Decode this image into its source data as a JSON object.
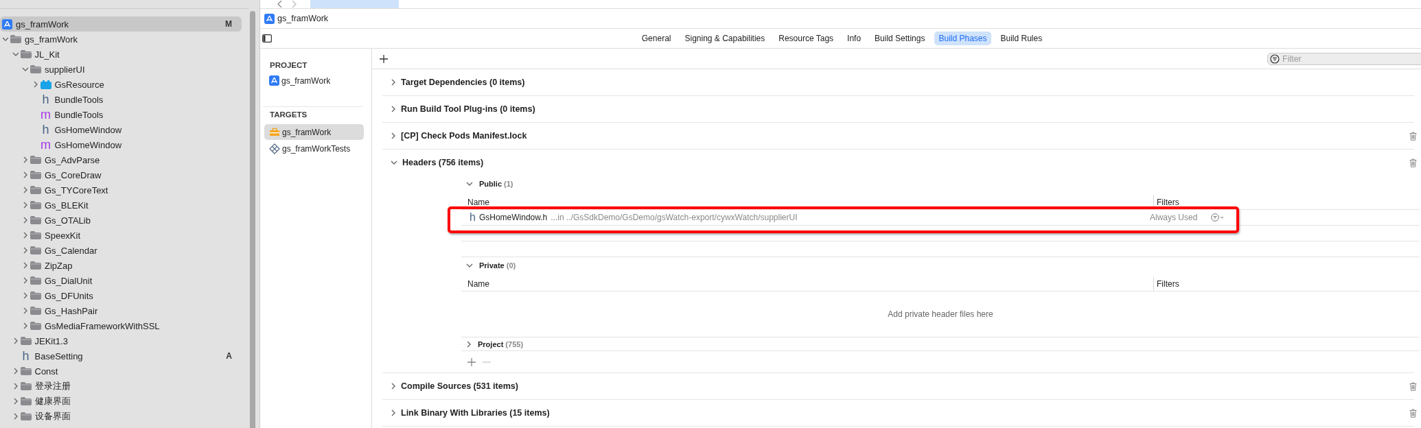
{
  "navigator": {
    "project": {
      "name": "gs_framWork",
      "badge": "M",
      "selected": true
    },
    "tree": [
      {
        "name": "gs_framWork",
        "kind": "folder",
        "expanded": true,
        "selected": false,
        "children": [
          {
            "name": "JL_Kit",
            "kind": "folder",
            "expanded": true,
            "selected": false,
            "children": [
              {
                "name": "supplierUI",
                "kind": "folder",
                "expanded": true,
                "selected": false,
                "children": [
                  {
                    "name": "GsResource",
                    "kind": "bundle",
                    "expanded": false,
                    "selected": false
                  },
                  {
                    "name": "BundleTools",
                    "kind": "header",
                    "glyph": "h",
                    "selected": false
                  },
                  {
                    "name": "BundleTools",
                    "kind": "impl",
                    "glyph": "m",
                    "selected": false
                  },
                  {
                    "name": "GsHomeWindow",
                    "kind": "header",
                    "glyph": "h",
                    "selected": false
                  },
                  {
                    "name": "GsHomeWindow",
                    "kind": "impl",
                    "glyph": "m",
                    "selected": false
                  }
                ]
              },
              {
                "name": "Gs_AdvParse",
                "kind": "folder",
                "expanded": false,
                "selected": false
              },
              {
                "name": "Gs_CoreDraw",
                "kind": "folder",
                "expanded": false,
                "selected": false
              },
              {
                "name": "Gs_TYCoreText",
                "kind": "folder",
                "expanded": false,
                "selected": false
              },
              {
                "name": "Gs_BLEKit",
                "kind": "folder",
                "expanded": false,
                "selected": false
              },
              {
                "name": "Gs_OTALib",
                "kind": "folder",
                "expanded": false,
                "selected": false
              },
              {
                "name": "SpeexKit",
                "kind": "folder",
                "expanded": false,
                "selected": false
              },
              {
                "name": "Gs_Calendar",
                "kind": "folder",
                "expanded": false,
                "selected": false
              },
              {
                "name": "ZipZap",
                "kind": "folder",
                "expanded": false,
                "selected": false
              },
              {
                "name": "Gs_DialUnit",
                "kind": "folder",
                "expanded": false,
                "selected": false
              },
              {
                "name": "Gs_DFUnits",
                "kind": "folder",
                "expanded": false,
                "selected": false
              },
              {
                "name": "Gs_HashPair",
                "kind": "folder",
                "expanded": false,
                "selected": false
              },
              {
                "name": "GsMediaFrameworkWithSSL",
                "kind": "folder",
                "expanded": false,
                "selected": false
              }
            ]
          },
          {
            "name": "JEKit1.3",
            "kind": "folder",
            "expanded": false,
            "selected": false
          },
          {
            "name": "BaseSetting",
            "kind": "header",
            "glyph": "h",
            "badge": "A",
            "selected": false
          },
          {
            "name": "Const",
            "kind": "folder",
            "expanded": false,
            "selected": false
          },
          {
            "name": "登录注册",
            "kind": "folder",
            "expanded": false,
            "selected": false
          },
          {
            "name": "健康界面",
            "kind": "folder",
            "expanded": false,
            "selected": false
          },
          {
            "name": "设备界面",
            "kind": "folder",
            "expanded": false,
            "selected": false
          }
        ]
      }
    ]
  },
  "editor": {
    "breadcrumb": "gs_framWork",
    "tabs": [
      {
        "label": "General",
        "selected": false
      },
      {
        "label": "Signing & Capabilities",
        "selected": false
      },
      {
        "label": "Resource Tags",
        "selected": false
      },
      {
        "label": "Info",
        "selected": false
      },
      {
        "label": "Build Settings",
        "selected": false
      },
      {
        "label": "Build Phases",
        "selected": true
      },
      {
        "label": "Build Rules",
        "selected": false
      }
    ],
    "project_heading": "PROJECT",
    "projects": [
      {
        "name": "gs_framWork",
        "selected": false
      }
    ],
    "targets_heading": "TARGETS",
    "targets": [
      {
        "name": "gs_framWork",
        "kind": "app",
        "selected": true
      },
      {
        "name": "gs_framWorkTests",
        "kind": "tests",
        "selected": false
      }
    ],
    "filter": {
      "placeholder": "Filter"
    },
    "phases": [
      {
        "title": "Target Dependencies (0 items)",
        "expanded": false,
        "removable": false
      },
      {
        "title": "Run Build Tool Plug-ins (0 items)",
        "expanded": false,
        "removable": false
      },
      {
        "title": "[CP] Check Pods Manifest.lock",
        "expanded": false,
        "removable": true
      },
      {
        "title": "Headers (756 items)",
        "expanded": true,
        "removable": true,
        "groups": [
          {
            "title": "Public",
            "count": "(1)",
            "expanded": true,
            "columns": [
              "Name",
              "Filters"
            ],
            "rows": [
              {
                "name": "GsHomeWindow.h",
                "glyph": "h",
                "path": "...in ../GsSdkDemo/GsDemo/gsWatch-export/cywxWatch/supplierUI",
                "filter": "Always Used",
                "highlighted": true
              }
            ]
          },
          {
            "title": "Private",
            "count": "(0)",
            "expanded": true,
            "columns": [
              "Name",
              "Filters"
            ],
            "empty_text": "Add private header files here"
          },
          {
            "title": "Project",
            "count": "(755)",
            "expanded": false
          }
        ]
      },
      {
        "title": "Compile Sources (531 items)",
        "expanded": false,
        "removable": true
      },
      {
        "title": "Link Binary With Libraries (15 items)",
        "expanded": false,
        "removable": true
      }
    ]
  }
}
